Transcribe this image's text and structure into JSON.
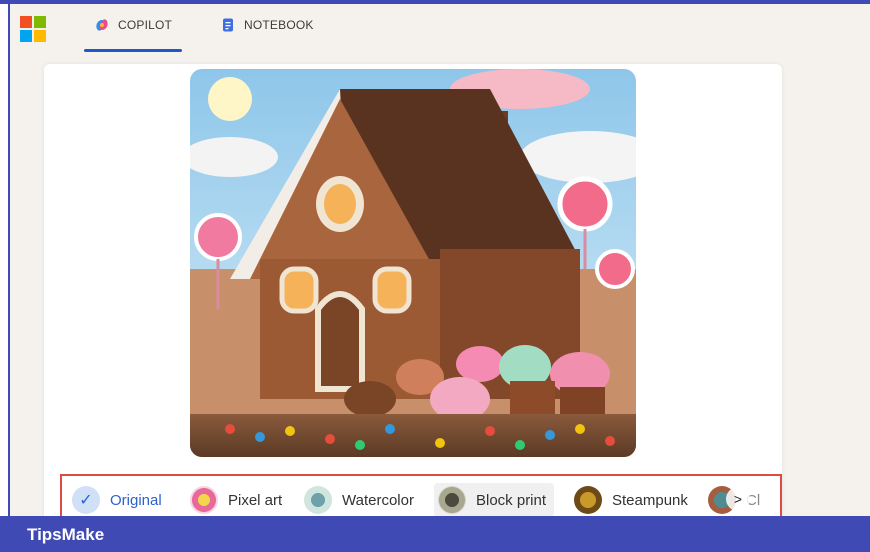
{
  "tabs": [
    {
      "label": "COPILOT",
      "icon": "copilot-icon",
      "active": true
    },
    {
      "label": "NOTEBOOK",
      "icon": "notebook-icon",
      "active": false
    }
  ],
  "image": {
    "subject": "gingerbread-house",
    "watermark": "TipsMake"
  },
  "styles": [
    {
      "label": "Original",
      "selected": true
    },
    {
      "label": "Pixel art"
    },
    {
      "label": "Watercolor"
    },
    {
      "label": "Block print"
    },
    {
      "label": "Steampunk"
    },
    {
      "label": "Cl"
    }
  ],
  "styles_next": ">",
  "footer": {
    "brand": "TipsMake"
  },
  "colors": {
    "accent": "#1f58c9",
    "frame": "#3f4ab4",
    "highlight": "#e04a45"
  }
}
